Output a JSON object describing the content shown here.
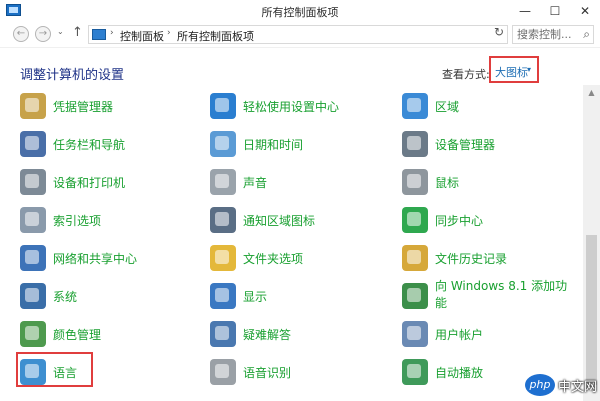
{
  "window": {
    "title": "所有控制面板项",
    "min": "—",
    "max": "☐",
    "close": "✕"
  },
  "address": {
    "crumbs": [
      "控制面板",
      "所有控制面板项"
    ],
    "search_placeholder": "搜索控制...",
    "back": "←",
    "forward": "→",
    "up": "↑",
    "recent": "⌄",
    "refresh": "↻",
    "search_icon": "⌕",
    "sep": "›"
  },
  "header": {
    "title": "调整计算机的设置",
    "view_by_label": "查看方式:",
    "view_by_value": "大图标",
    "view_by_chevron": "▾"
  },
  "items": [
    {
      "label": "凭据管理器",
      "icon": "credential-manager-icon",
      "color": "#c7a24a"
    },
    {
      "label": "轻松使用设置中心",
      "icon": "ease-of-access-icon",
      "color": "#2a7ed0"
    },
    {
      "label": "区域",
      "icon": "region-icon",
      "color": "#3a8ad6"
    },
    {
      "label": "任务栏和导航",
      "icon": "taskbar-icon",
      "color": "#4a6fa8"
    },
    {
      "label": "日期和时间",
      "icon": "date-time-icon",
      "color": "#5b9bd5"
    },
    {
      "label": "设备管理器",
      "icon": "device-manager-icon",
      "color": "#6b7a88"
    },
    {
      "label": "设备和打印机",
      "icon": "printer-icon",
      "color": "#7d8a96"
    },
    {
      "label": "声音",
      "icon": "sound-icon",
      "color": "#9aa3ab"
    },
    {
      "label": "鼠标",
      "icon": "mouse-icon",
      "color": "#8e969d"
    },
    {
      "label": "索引选项",
      "icon": "indexing-icon",
      "color": "#8a9aab"
    },
    {
      "label": "通知区域图标",
      "icon": "notification-area-icon",
      "color": "#5a6e85"
    },
    {
      "label": "同步中心",
      "icon": "sync-center-icon",
      "color": "#2fa84f"
    },
    {
      "label": "网络和共享中心",
      "icon": "network-icon",
      "color": "#3d73b8"
    },
    {
      "label": "文件夹选项",
      "icon": "folder-options-icon",
      "color": "#e4b83a"
    },
    {
      "label": "文件历史记录",
      "icon": "file-history-icon",
      "color": "#d6a83a"
    },
    {
      "label": "系统",
      "icon": "system-icon",
      "color": "#3a6ea8"
    },
    {
      "label": "显示",
      "icon": "display-icon",
      "color": "#3a78c2"
    },
    {
      "label": "向 Windows 8.1 添加功",
      "label2": "能",
      "icon": "add-features-icon",
      "color": "#3c8f4a"
    },
    {
      "label": "颜色管理",
      "icon": "color-management-icon",
      "color": "#4e9a4e"
    },
    {
      "label": "疑难解答",
      "icon": "troubleshooting-icon",
      "color": "#4a78b0"
    },
    {
      "label": "用户帐户",
      "icon": "user-accounts-icon",
      "color": "#6a8ab4"
    },
    {
      "label": "语言",
      "icon": "language-icon",
      "color": "#3e8fd0"
    },
    {
      "label": "语音识别",
      "icon": "speech-recognition-icon",
      "color": "#9aa0a6"
    },
    {
      "label": "自动播放",
      "icon": "autoplay-icon",
      "color": "#3f9a5a"
    }
  ],
  "scrollbar": {
    "up": "▲"
  },
  "watermark": {
    "badge": "php",
    "text": "中文网"
  }
}
